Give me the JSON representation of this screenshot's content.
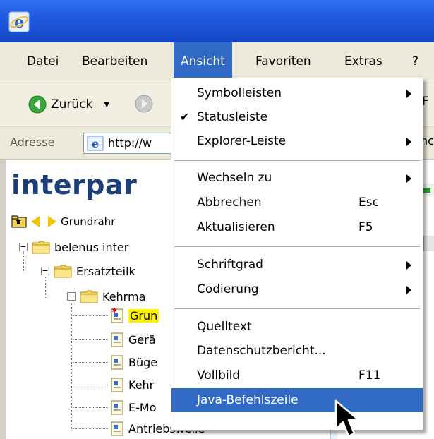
{
  "menubar": {
    "items": [
      "Datei",
      "Bearbeiten",
      "Ansicht",
      "Favoriten",
      "Extras",
      "?"
    ],
    "active": "Ansicht"
  },
  "toolbar": {
    "back_label": "Zurück",
    "peek_char": "F"
  },
  "address": {
    "label": "Adresse",
    "value": "http://w",
    "peek_text": "nc"
  },
  "page": {
    "brand": "interpar",
    "tree_nav_label": "Grundrahr",
    "tree": [
      {
        "label": "belenus inter",
        "type": "folder"
      },
      {
        "label": "Ersatzteilk",
        "type": "folder"
      },
      {
        "label": "Kehrma",
        "type": "folder"
      },
      {
        "label": "Grun",
        "type": "doc",
        "highlight": true
      },
      {
        "label": "Gerä",
        "type": "doc"
      },
      {
        "label": "Büge",
        "type": "doc"
      },
      {
        "label": "Kehr",
        "type": "doc"
      },
      {
        "label": "E-Mo",
        "type": "doc"
      },
      {
        "label": "Antriebswelle",
        "type": "doc"
      }
    ]
  },
  "dropdown": {
    "items": [
      {
        "label": "Symbolleisten",
        "submenu": true
      },
      {
        "label": "Statusleiste",
        "checked": true
      },
      {
        "label": "Explorer-Leiste",
        "submenu": true
      },
      {
        "label": "Wechseln zu",
        "submenu": true
      },
      {
        "label": "Abbrechen",
        "shortcut": "Esc"
      },
      {
        "label": "Aktualisieren",
        "shortcut": "F5"
      },
      {
        "label": "Schriftgrad",
        "submenu": true
      },
      {
        "label": "Codierung",
        "submenu": true
      },
      {
        "label": "Quelltext"
      },
      {
        "label": "Datenschutzbericht..."
      },
      {
        "label": "Vollbild",
        "shortcut": "F11"
      },
      {
        "label": "Java-Befehlszeile",
        "highlighted": true
      }
    ],
    "check_glyph": "✔"
  },
  "colors": {
    "titlebar": "#1f5be0",
    "menu_highlight": "#316ac5",
    "tree_highlight": "#fff200",
    "brand": "#1d3f7a"
  },
  "icons": {
    "app": "ie-icon",
    "back": "back-arrow-icon",
    "forward": "forward-arrow-icon",
    "address": "ie-page-icon",
    "folder": "folder-icon",
    "doc": "document-icon",
    "cursor": "mouse-pointer-icon"
  }
}
